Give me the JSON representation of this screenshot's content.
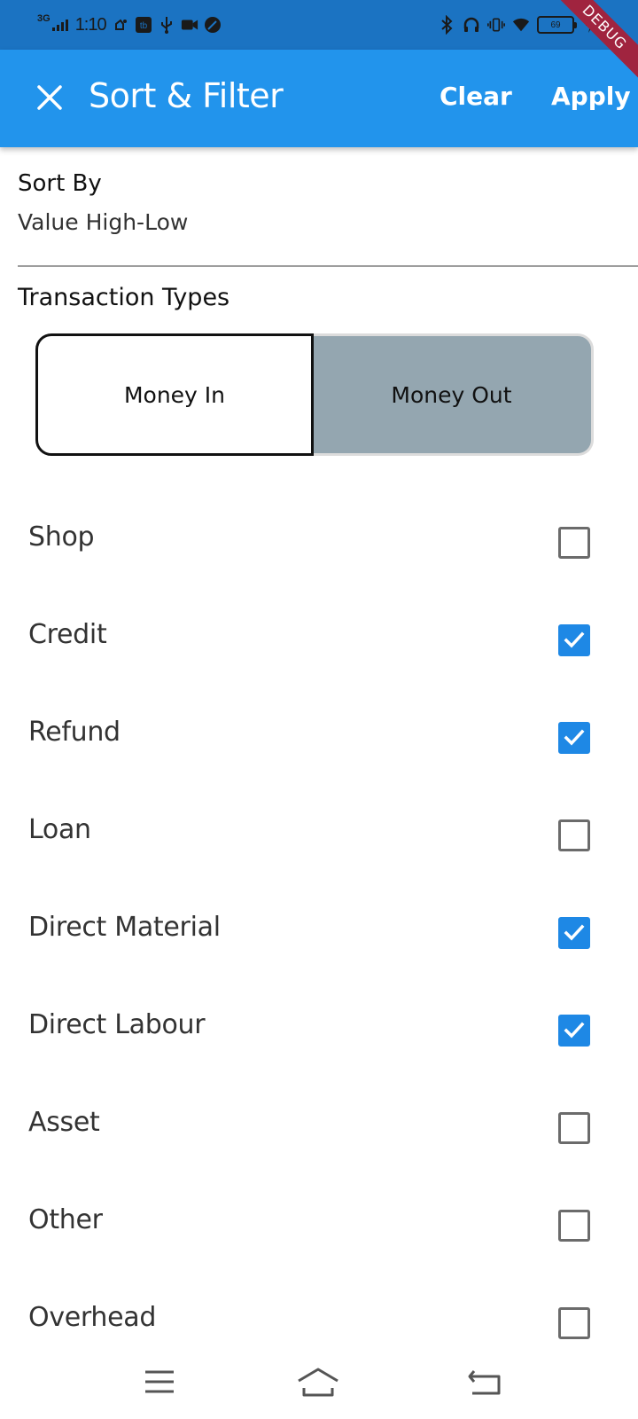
{
  "status_bar": {
    "network": "3G",
    "time": "1:10",
    "battery": "69",
    "icons": [
      "signal-icon",
      "notification-icon",
      "app-icon",
      "usb-icon",
      "video-icon",
      "leaf-icon",
      "bluetooth-icon",
      "headphones-icon",
      "vibrate-icon",
      "wifi-icon",
      "battery-icon",
      "charging-icon"
    ]
  },
  "debug_banner": "DEBUG",
  "app_bar": {
    "title": "Sort & Filter",
    "clear_label": "Clear",
    "apply_label": "Apply",
    "background": "#2294ec"
  },
  "sort": {
    "label": "Sort By",
    "value": "Value High-Low"
  },
  "transaction_types": {
    "label": "Transaction Types",
    "options": [
      "Money In",
      "Money Out"
    ],
    "selected": "Money In"
  },
  "categories": [
    {
      "label": "Shop",
      "checked": false
    },
    {
      "label": "Credit",
      "checked": true
    },
    {
      "label": "Refund",
      "checked": true
    },
    {
      "label": "Loan",
      "checked": false
    },
    {
      "label": "Direct Material",
      "checked": true
    },
    {
      "label": "Direct Labour",
      "checked": true
    },
    {
      "label": "Asset",
      "checked": false
    },
    {
      "label": "Other",
      "checked": false
    },
    {
      "label": "Overhead",
      "checked": false
    }
  ],
  "colors": {
    "accent": "#1e88e5",
    "status_bar": "#1b73c2",
    "unselected_segment": "#94a6b0",
    "debug_ribbon": "#a0243f"
  },
  "nav_bar": {
    "icons": [
      "menu-icon",
      "home-icon",
      "back-icon"
    ]
  }
}
